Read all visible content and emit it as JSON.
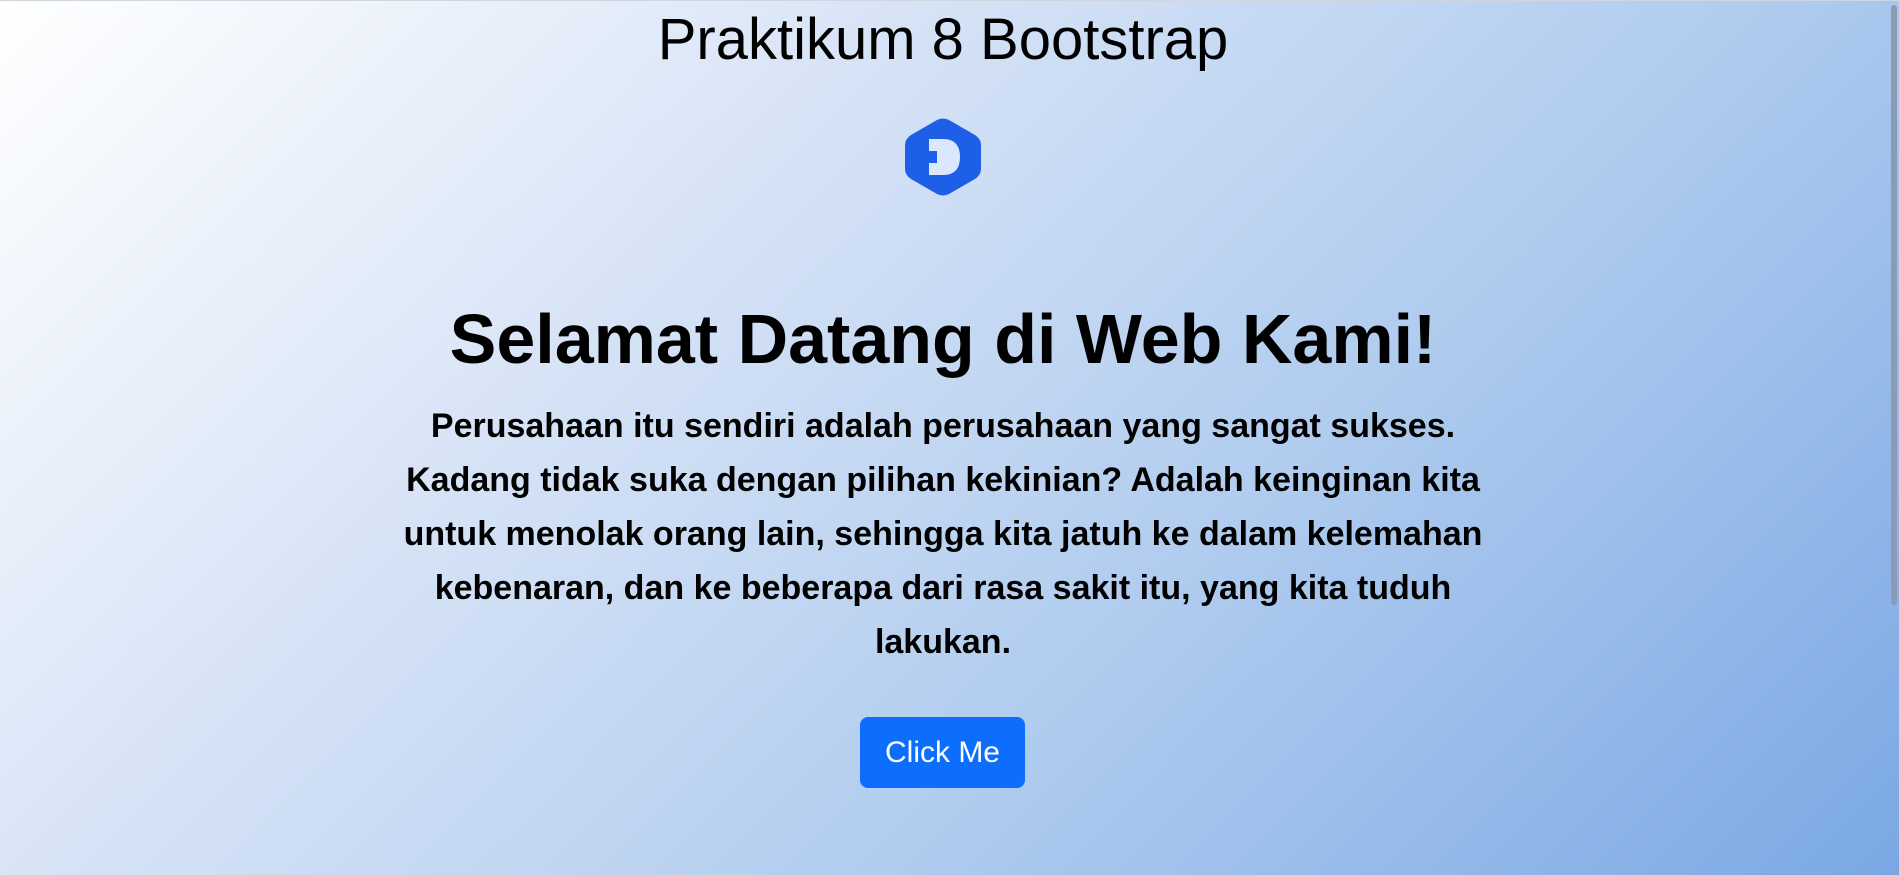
{
  "page": {
    "title": "Praktikum 8 Bootstrap",
    "logo": {
      "icon": "hexagon-d-logo-icon",
      "color": "#1d5fe6"
    },
    "hero": {
      "heading": "Selamat Datang di Web Kami!",
      "lead": "Perusahaan itu sendiri adalah perusahaan yang sangat sukses. Kadang tidak suka dengan pilihan kekinian? Adalah keinginan kita untuk menolak orang lain, sehingga kita jatuh ke dalam kelemahan kebenaran, dan ke beberapa dari rasa sakit itu, yang kita tuduh lakukan.",
      "button_label": "Click Me",
      "button_color": "#0d6efd"
    }
  }
}
